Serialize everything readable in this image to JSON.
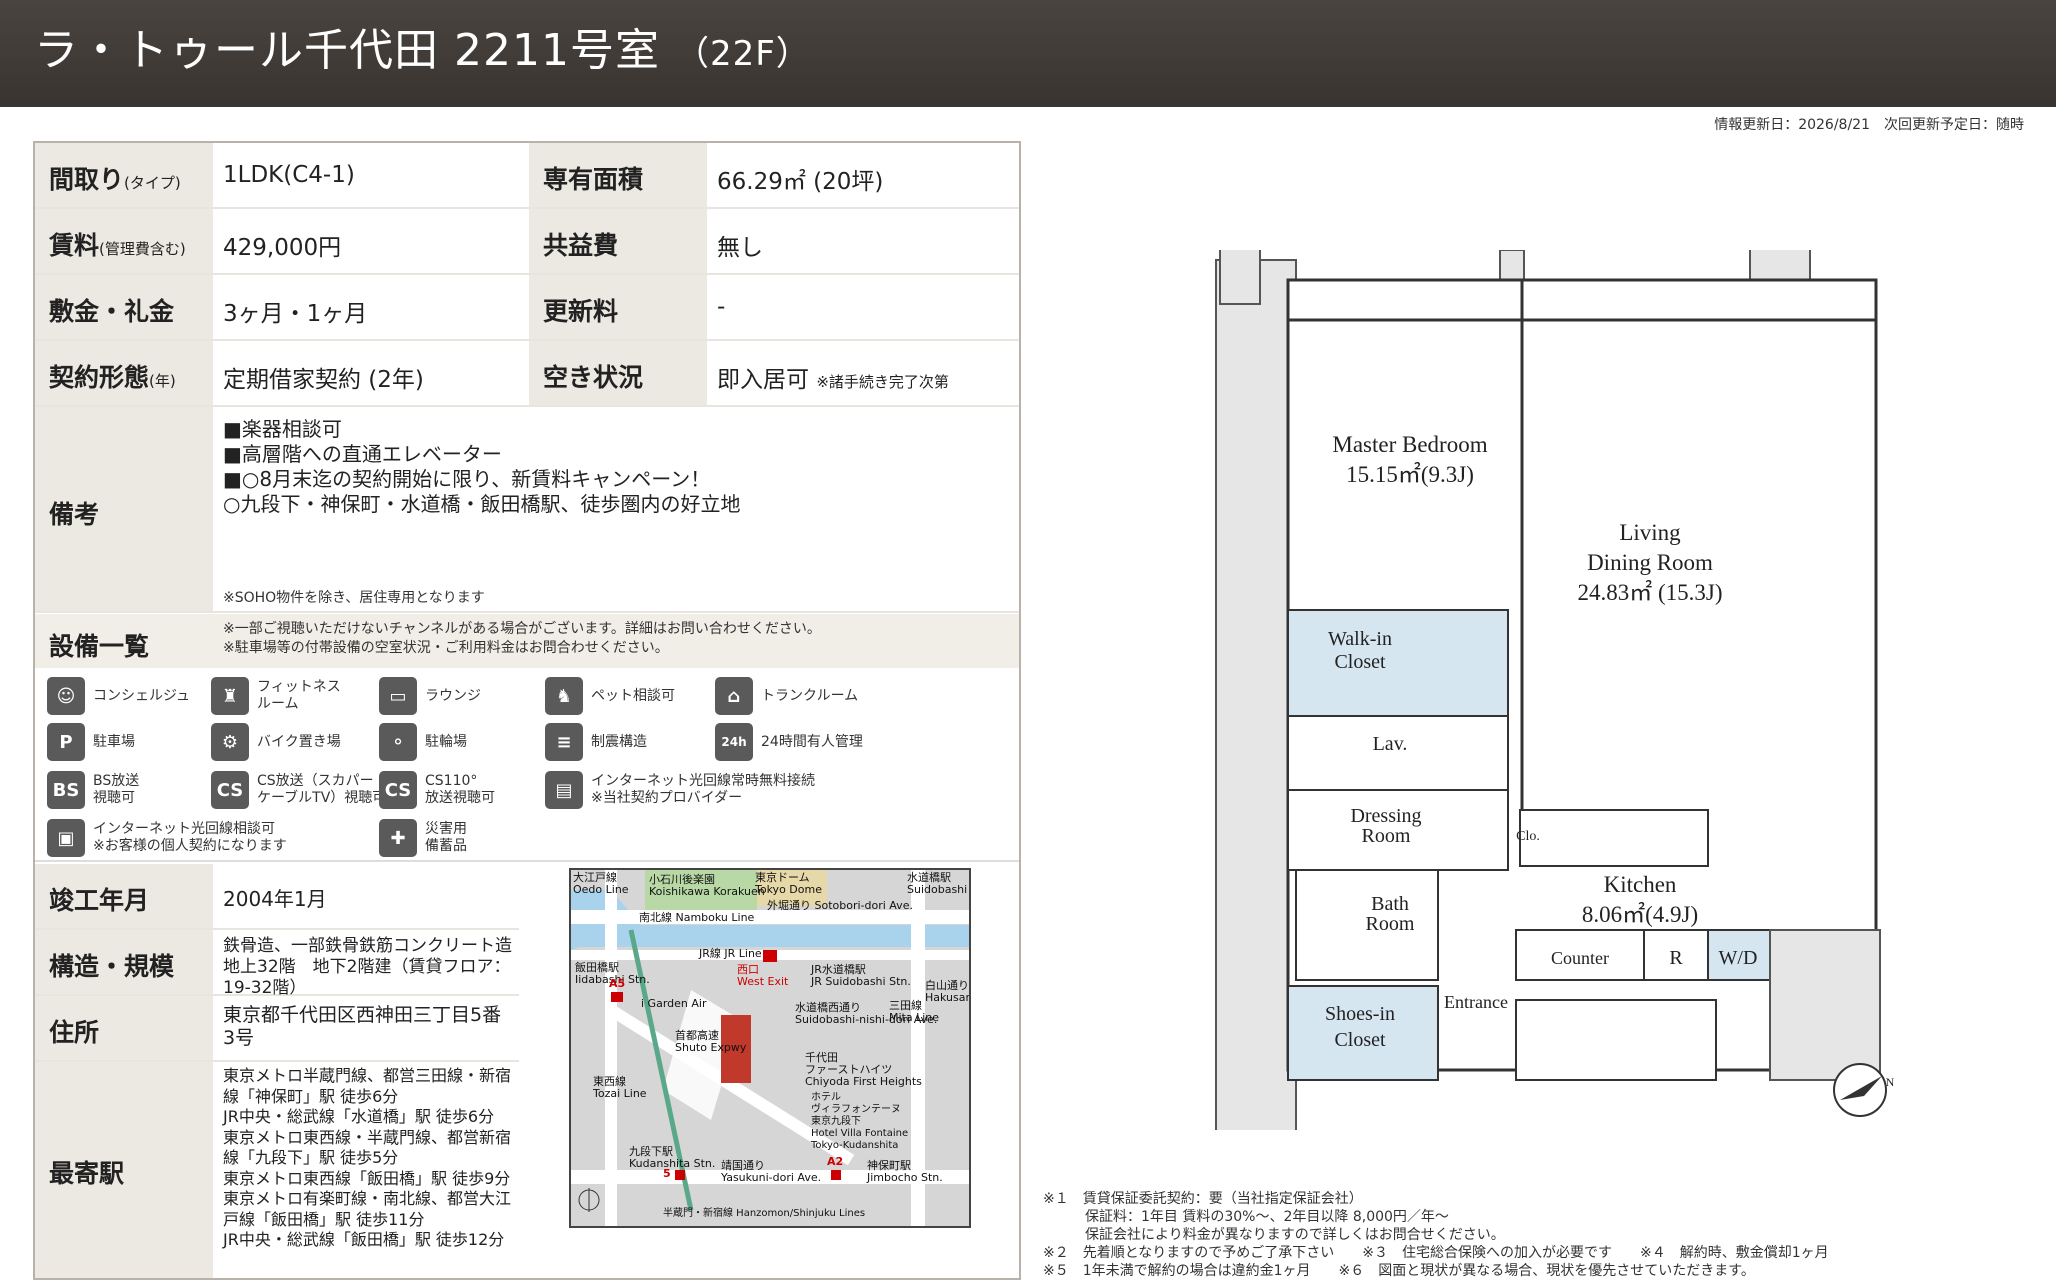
{
  "header": {
    "title": "ラ・トゥール千代田 2211号室",
    "floor": "（22F）"
  },
  "update_info": "情報更新日：2026/8/21　次回更新予定日：随時",
  "specs": {
    "layout_label": "間取り",
    "layout_sub": "(タイプ)",
    "layout_value": "1LDK(C4-1)",
    "area_label": "専有面積",
    "area_value": "66.29㎡ (20坪)",
    "rent_label": "賃料",
    "rent_sub": "(管理費含む)",
    "rent_value": "429,000円",
    "common_label": "共益費",
    "common_value": "無し",
    "deposit_label": "敷金・礼金",
    "deposit_value": "3ヶ月・1ヶ月",
    "renewal_label": "更新料",
    "renewal_value": "-",
    "contract_label": "契約形態",
    "contract_sub": "(年)",
    "contract_value": "定期借家契約 (2年)",
    "vacancy_label": "空き状況",
    "vacancy_value": "即入居可",
    "vacancy_note": "※諸手続き完了次第"
  },
  "remarks": {
    "label": "備考",
    "lines": [
      "■楽器相談可",
      "■高層階への直通エレベーター",
      "■○8月末迄の契約開始に限り、新賃料キャンペーン！",
      "○九段下・神保町・水道橋・飯田橋駅、徒歩圏内の好立地"
    ],
    "footer": "※SOHO物件を除き、居住専用となります"
  },
  "equipment": {
    "label": "設備一覧",
    "note1": "※一部ご視聴いただけないチャンネルがある場合がございます。詳細はお問い合わせください。",
    "note2": "※駐車場等の付帯設備の空室状況・ご利用料金はお問合わせください。",
    "items": [
      {
        "label": "コンシェルジュ",
        "glyph": "☺"
      },
      {
        "label": "フィットネス\nルーム",
        "glyph": "♜"
      },
      {
        "label": "ラウンジ",
        "glyph": "▭"
      },
      {
        "label": "ペット相談可",
        "glyph": "♞"
      },
      {
        "label": "トランクルーム",
        "glyph": "⌂"
      },
      {
        "label": "駐車場",
        "glyph": "P"
      },
      {
        "label": "バイク置き場",
        "glyph": "⚙"
      },
      {
        "label": "駐輪場",
        "glyph": "⚬"
      },
      {
        "label": "制震構造",
        "glyph": "≡"
      },
      {
        "label": "24時間有人管理",
        "glyph": "24h"
      },
      {
        "label": "BS放送\n視聴可",
        "glyph": "BS"
      },
      {
        "label": "CS放送（スカパー・\nケーブルTV）視聴可",
        "glyph": "CS"
      },
      {
        "label": "CS110°\n放送視聴可",
        "glyph": "CS"
      },
      {
        "label": "インターネット光回線常時無料接続\n※当社契約プロバイダー",
        "glyph": "▤"
      },
      {
        "label": "インターネット光回線相談可\n※お客様の個人契約になります",
        "glyph": "▣"
      },
      {
        "label": "災害用\n備蓄品",
        "glyph": "✚"
      }
    ]
  },
  "building": {
    "built_label": "竣工年月",
    "built_value": "2004年1月",
    "structure_label": "構造・規模",
    "structure_value": "鉄骨造、一部鉄骨鉄筋コンクリート造　地上32階　地下2階建（賃貸フロア：19-32階）",
    "address_label": "住所",
    "address_value": "東京都千代田区西神田三丁目5番3号",
    "station_label": "最寄駅",
    "stations": [
      "東京メトロ半蔵門線、都営三田線・新宿線「神保町」駅 徒歩6分",
      "JR中央・総武線「水道橋」駅 徒歩6分",
      "東京メトロ東西線・半蔵門線、都営新宿線「九段下」駅 徒歩5分",
      "東京メトロ東西線「飯田橋」駅 徒歩9分",
      "東京メトロ有楽町線・南北線、都営大江戸線「飯田橋」駅 徒歩11分",
      "JR中央・総武線「飯田橋」駅 徒歩12分"
    ]
  },
  "map": {
    "labels": {
      "oedo": "大江戸線\nOedo Line",
      "koishikawa": "小石川後楽園\nKoishikawa Korakuen",
      "dome": "東京ドーム\nTokyo Dome",
      "suidobashi_stn": "水道橋駅\nSuidobashi Stn.",
      "sotobori": "外堀通り Sotobori-dori Ave.",
      "namboku": "南北線 Namboku Line",
      "jr_line": "JR線 JR Line",
      "iidabashi": "飯田橋駅\nIidabashi Stn.",
      "west_exit": "西口\nWest Exit",
      "jr_suidobashi": "JR水道橋駅\nJR Suidobashi Stn.",
      "igarden": "i Garden Air",
      "suidobashi_nishi": "水道橋西通り\nSuidobashi-nishi-dori Ave.",
      "hakusan": "白山通り\nHakusan-dori Ave.",
      "mita": "三田線\nMita Line",
      "shuto": "首都高速\nShuto Expwy",
      "chiyoda": "千代田\nファーストハイツ\nChiyoda First Heights",
      "villa": "ホテル\nヴィラフォンテーヌ\n東京九段下\nHotel Villa Fontaine\nTokyo-Kudanshita",
      "tozai": "東西線\nTozai Line",
      "kudanshita": "九段下駅\nKudanshita Stn.",
      "yasukuni": "靖国通り\nYasukuni-dori Ave.",
      "jimbocho": "神保町駅\nJimbocho Stn.",
      "bottom": "半蔵門・新宿線 Hanzomon/Shinjuku Lines",
      "a5": "A5",
      "a2": "A2",
      "five": "5"
    }
  },
  "floorplan": {
    "master": "Master Bedroom",
    "master_area": "15.15㎡(9.3J)",
    "living1": "Living",
    "living2": "Dining Room",
    "living_area": "24.83㎡ (15.3J)",
    "walkin1": "Walk-in",
    "walkin2": "Closet",
    "lav": "Lav.",
    "dressing1": "Dressing",
    "dressing2": "Room",
    "bath1": "Bath",
    "bath2": "Room",
    "shoes1": "Shoes-in",
    "shoes2": "Closet",
    "entrance": "Entrance",
    "kitchen": "Kitchen",
    "kitchen_area": "8.06㎡(4.9J)",
    "counter": "Counter",
    "r": "R",
    "wd": "W/D",
    "clo": "Clo.",
    "compass": "N"
  },
  "footnotes": [
    "※１　賃貸保証委託契約：要（当社指定保証会社）",
    "　　　保証料：1年目 賃料の30%〜、2年目以降 8,000円／年〜",
    "　　　保証会社により料金が異なりますので詳しくはお問合せください。",
    "※２　先着順となりますので予めご了承下さい　　※３　住宅総合保険への加入が必要です　　※４　解約時、敷金償却1ヶ月",
    "※５　1年未満で解約の場合は違約金1ヶ月　　※６　図面と現状が異なる場合、現状を優先させていただきます。"
  ],
  "colors": {
    "header": "#3e3834",
    "label_bg": "#ece8e2",
    "closet_fill": "#d6e6f0"
  }
}
